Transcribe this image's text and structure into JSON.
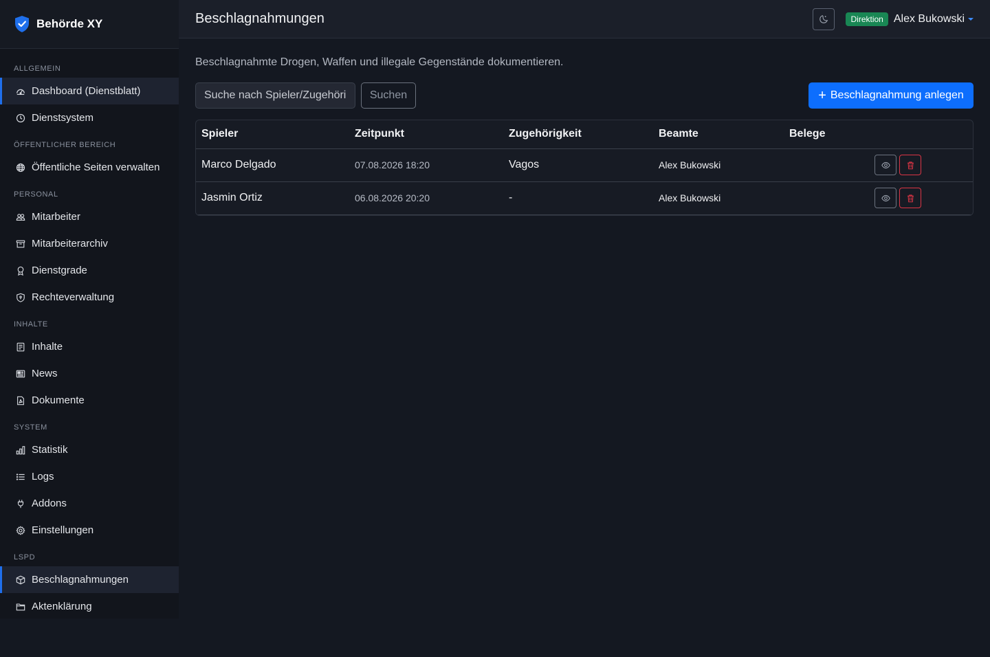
{
  "brand": {
    "name": "Behörde XY",
    "logo_icon": "shield-check-icon",
    "accent": "#1f6feb"
  },
  "sidebar": {
    "sections": [
      {
        "title": "ALLGEMEIN",
        "items": [
          {
            "label": "Dashboard (Dienstblatt)",
            "icon": "speedometer-icon"
          },
          {
            "label": "Dienstsystem",
            "icon": "clock-icon"
          }
        ]
      },
      {
        "title": "ÖFFENTLICHER BEREICH",
        "items": [
          {
            "label": "Öffentliche Seiten verwalten",
            "icon": "globe-icon"
          }
        ]
      },
      {
        "title": "PERSONAL",
        "items": [
          {
            "label": "Mitarbeiter",
            "icon": "people-icon"
          },
          {
            "label": "Mitarbeiterarchiv",
            "icon": "archive-icon"
          },
          {
            "label": "Dienstgrade",
            "icon": "award-icon"
          },
          {
            "label": "Rechteverwaltung",
            "icon": "shield-icon"
          }
        ]
      },
      {
        "title": "INHALTE",
        "items": [
          {
            "label": "Inhalte",
            "icon": "file-text-icon"
          },
          {
            "label": "News",
            "icon": "newspaper-icon"
          },
          {
            "label": "Dokumente",
            "icon": "file-pdf-icon"
          }
        ]
      },
      {
        "title": "SYSTEM",
        "items": [
          {
            "label": "Statistik",
            "icon": "bar-chart-icon"
          },
          {
            "label": "Logs",
            "icon": "list-icon"
          },
          {
            "label": "Addons",
            "icon": "plug-icon"
          },
          {
            "label": "Einstellungen",
            "icon": "gear-icon"
          }
        ]
      },
      {
        "title": "LSPD",
        "items": [
          {
            "label": "Beschlagnahmungen",
            "icon": "box-icon",
            "active": true
          },
          {
            "label": "Aktenklärung",
            "icon": "folder-icon"
          }
        ]
      }
    ]
  },
  "header": {
    "title": "Beschlagnahmungen",
    "theme_icon": "moon-stars-icon",
    "role_badge": "Direktion",
    "role_color": "#198754",
    "user_name": "Alex Bukowski"
  },
  "main": {
    "subtitle": "Beschlagnahmte Drogen, Waffen und illegale Gegenstände dokumentieren.",
    "search": {
      "placeholder": "Suche nach Spieler/Zugehörigkeit",
      "value": ""
    },
    "search_button": "Suchen",
    "add_button": "Beschlagnahmung anlegen",
    "add_color": "#0d6efd"
  },
  "table": {
    "headers": [
      "Spieler",
      "Zeitpunkt",
      "Zugehörigkeit",
      "Beamte",
      "Belege"
    ],
    "rows": [
      {
        "player": "Marco Delgado",
        "time": "07.08.2026 18:20",
        "affiliation": "Vagos",
        "officer": "Alex Bukowski",
        "evidence": ""
      },
      {
        "player": "Jasmin Ortiz",
        "time": "06.08.2026 20:20",
        "affiliation": "-",
        "officer": "Alex Bukowski",
        "evidence": ""
      }
    ]
  }
}
